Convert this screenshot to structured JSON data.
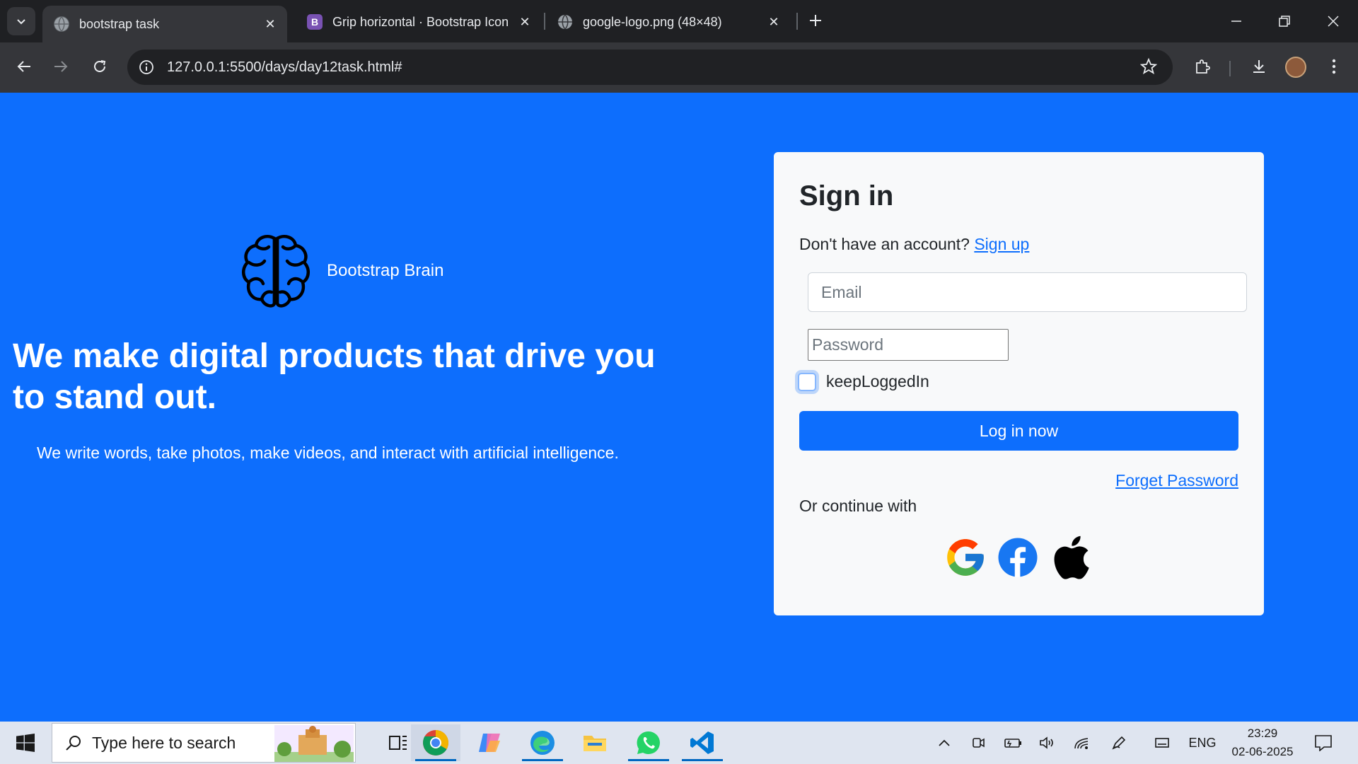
{
  "browser": {
    "tabs": [
      {
        "title": "bootstrap task",
        "active": true
      },
      {
        "title": "Grip horizontal · Bootstrap Icon",
        "active": false
      },
      {
        "title": "google-logo.png (48×48)",
        "active": false
      }
    ],
    "url": "127.0.0.1:5500/days/day12task.html#"
  },
  "hero": {
    "brand_name": "Bootstrap Brain",
    "headline": "We make digital products that drive you to stand out.",
    "subline": "We write words, take photos, make videos, and interact with artificial intelligence."
  },
  "signin": {
    "title": "Sign in",
    "no_account_text": "Don't have an account?",
    "signup_link": "Sign up",
    "email_placeholder": "Email",
    "password_placeholder": "Password",
    "keep_logged_in_label": "keepLoggedIn",
    "login_button": "Log in now",
    "forget_password": "Forget Password",
    "continue_with": "Or continue with",
    "social": [
      "google-icon",
      "facebook-icon",
      "apple-icon"
    ]
  },
  "taskbar": {
    "search_placeholder": "Type here to search",
    "language": "ENG",
    "time": "23:29",
    "date": "02-06-2025"
  },
  "colors": {
    "primary": "#0d6efd",
    "card_bg": "#f8f9fa",
    "chrome_dark": "#202124"
  }
}
